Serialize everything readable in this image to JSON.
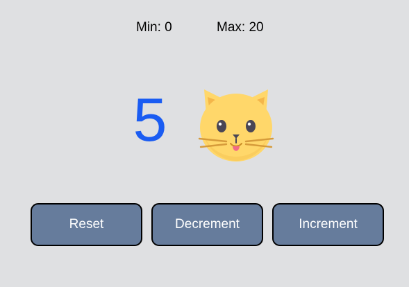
{
  "limits": {
    "min_label": "Min: 0",
    "max_label": "Max: 20"
  },
  "counter": {
    "value": "5",
    "value_color": "#1a5cf2"
  },
  "icon": {
    "name": "cat-face-icon",
    "primary_color": "#ffd76a",
    "ear_inner_color": "#f4b64a"
  },
  "controls": {
    "reset_label": "Reset",
    "decrement_label": "Decrement",
    "increment_label": "Increment",
    "button_color": "#667c9c"
  }
}
